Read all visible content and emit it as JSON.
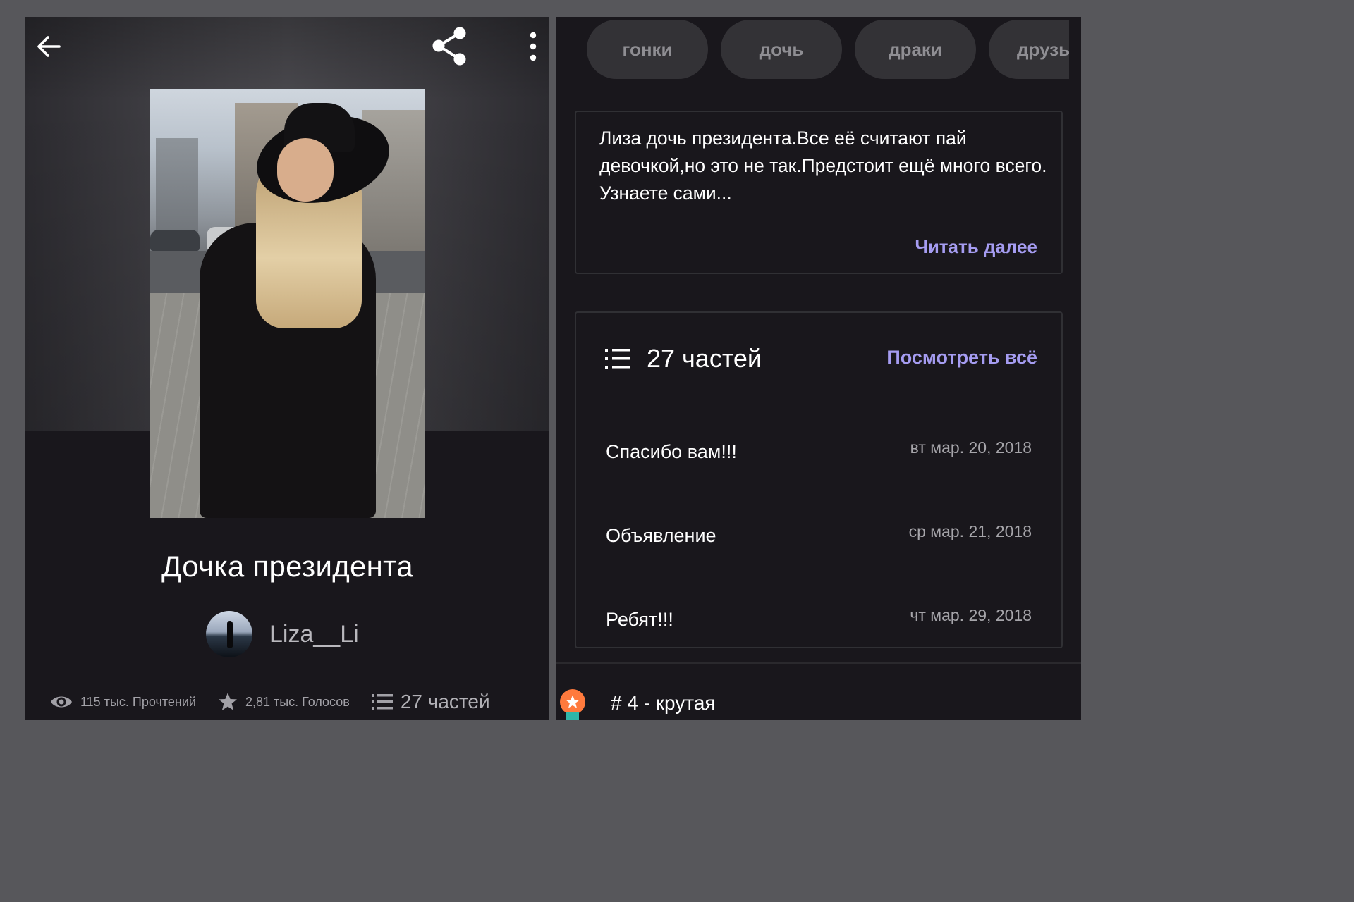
{
  "left": {
    "story_title": "Дочка президента",
    "author": "Liza__Li",
    "stats": {
      "reads": "115 тыс. Прочтений",
      "votes": "2,81 тыс. Голосов",
      "parts": "27 частей"
    },
    "icons": {
      "back": "arrow-left-icon",
      "share": "share-icon",
      "more": "more-vertical-icon",
      "reads": "eye-icon",
      "votes": "star-icon",
      "parts": "list-icon"
    }
  },
  "right": {
    "tags": [
      "гонки",
      "дочь",
      "драки",
      "друзья"
    ],
    "description": "Лиза дочь президента.Все её считают пай девочкой,но это не так.Предстоит ещё много всего.\nУзнаете сами...",
    "read_more": "Читать далее",
    "parts": {
      "title": "27 частей",
      "view_all": "Посмотреть всё",
      "items": [
        {
          "name": "Спасибо вам!!!",
          "date": "вт мар. 20, 2018"
        },
        {
          "name": "Объявление",
          "date": "ср мар. 21, 2018"
        },
        {
          "name": "Ребят!!!",
          "date": "чт мар. 29, 2018"
        }
      ]
    },
    "rank": "# 4 - крутая"
  },
  "colors": {
    "background": "#19171c",
    "frame": "#57575b",
    "accent": "#a59cf1",
    "tag_bg": "#333236",
    "rank_badge": "#ff7a3d",
    "rank_badge_ribbon": "#2fb7a8"
  }
}
